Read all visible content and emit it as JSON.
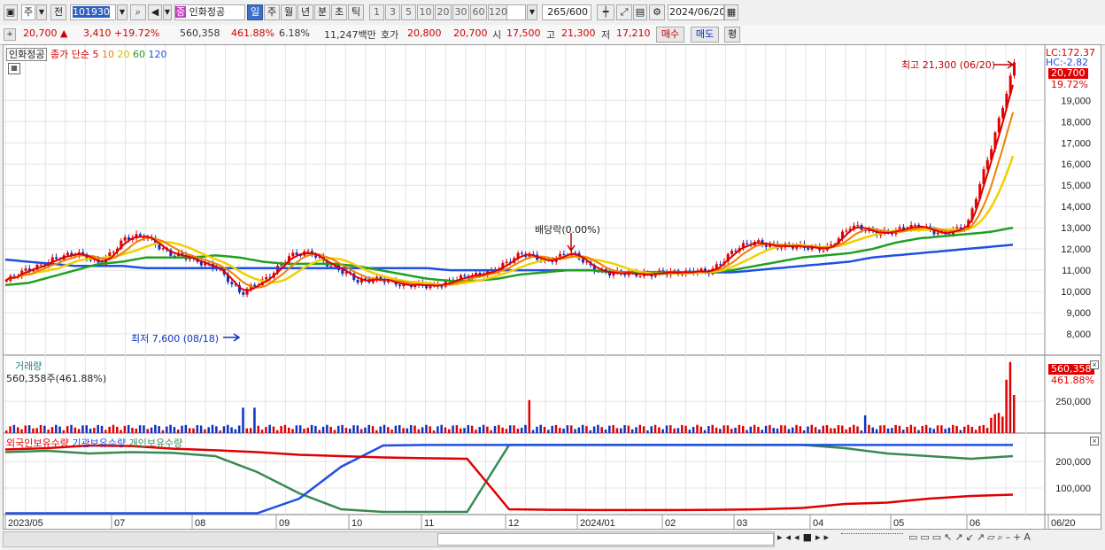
{
  "toolbar1": {
    "type_sel": "주",
    "prev_label": "전",
    "code": "101930",
    "badge": "중",
    "name": "인화정공",
    "periods": [
      "일",
      "주",
      "월",
      "년",
      "분",
      "초",
      "틱"
    ],
    "active_period": "일",
    "nums": [
      "1",
      "3",
      "5",
      "10",
      "20",
      "30",
      "60",
      "120"
    ],
    "count": "265",
    "count_total": "/600",
    "date": "2024/06/20"
  },
  "toolbar2": {
    "price": "20,700 ▲",
    "change": "3,410 +19.72%",
    "volume": "560,358",
    "volume_pct": "461.88%",
    "turnover": "6.18%",
    "amount": "11,247백만",
    "ask_label": "호가",
    "ask1": "20,800",
    "ask2": "20,700",
    "open_label": "시",
    "open": "17,500",
    "high_label": "고",
    "high": "21,300",
    "low_label": "저",
    "low": "17,210",
    "buy": "매수",
    "sell": "매도",
    "eval": "평"
  },
  "legend": {
    "name": "인화정공",
    "ma_label": "종가 단순",
    "ma": [
      "5",
      "10",
      "20",
      "60",
      "120"
    ],
    "volume_title": "거래량",
    "volume_value": "560,358주(461.88%)",
    "holdings": [
      "외국인보유수량",
      "기관보유수량",
      "개인보유수량"
    ]
  },
  "annotations": {
    "lc": "LC:172.37",
    "hc": "HC:-2.82",
    "high": "최고 21,300 (06/20)",
    "low": "최저 7,600 (08/18)",
    "dividend": "배당락(0.00%)",
    "price_tag": "20,700",
    "pct_tag": "19.72%",
    "vol_tag": "560,358",
    "vol_pct_tag": "461.88%"
  },
  "colors": {
    "up": "#e00000",
    "down": "#1030c0",
    "ma5": "#e00000",
    "ma10": "#f08000",
    "ma20": "#f0d000",
    "ma60": "#20a020",
    "ma120": "#2050e0",
    "foreign": "#e00000",
    "institution": "#2050e0",
    "individual": "#3a8a50"
  },
  "chart_data": [
    {
      "type": "line",
      "title": "인화정공 일봉",
      "y_ticks": [
        8000,
        9000,
        10000,
        11000,
        12000,
        13000,
        14000,
        15000,
        16000,
        17000,
        18000,
        19000
      ],
      "ylim": [
        7000,
        21600
      ],
      "x_ticks": [
        "2023/05",
        "07",
        "08",
        "09",
        "10",
        "11",
        "12",
        "2024/01",
        "02",
        "03",
        "04",
        "05",
        "06",
        "06/20"
      ],
      "series": [
        {
          "name": "종가",
          "values": [
            10500,
            11000,
            11600,
            11700,
            11400,
            12400,
            12600,
            11800,
            11400,
            11200,
            9800,
            10600,
            11600,
            11800,
            11200,
            10400,
            10700,
            10200,
            10300,
            10500,
            10700,
            11200,
            11700,
            11500,
            11800,
            11100,
            10900,
            10700,
            11000,
            10800,
            11000,
            11900,
            12300,
            12200,
            12000,
            12100,
            13000,
            12800,
            12900,
            13000,
            12800,
            13000,
            16800,
            20700
          ]
        },
        {
          "name": "120",
          "values": [
            11500,
            11400,
            11300,
            11200,
            11200,
            11200,
            11100,
            11100,
            11100,
            11100,
            11100,
            11100,
            11100,
            11100,
            11100,
            11100,
            11100,
            11100,
            11100,
            11000,
            11000,
            11000,
            11000,
            11000,
            11000,
            11000,
            10900,
            10900,
            10900,
            10900,
            10900,
            10900,
            11000,
            11100,
            11200,
            11300,
            11400,
            11600,
            11700,
            11800,
            11900,
            12000,
            12100,
            12200
          ]
        },
        {
          "name": "60",
          "values": [
            10300,
            10400,
            10700,
            11000,
            11300,
            11400,
            11600,
            11600,
            11600,
            11700,
            11600,
            11400,
            11300,
            11300,
            11300,
            11200,
            11000,
            10800,
            10600,
            10500,
            10500,
            10600,
            10800,
            10900,
            11000,
            11000,
            10900,
            10900,
            10900,
            10900,
            10900,
            11000,
            11200,
            11400,
            11600,
            11700,
            11800,
            12000,
            12300,
            12500,
            12600,
            12700,
            12800,
            13000
          ]
        }
      ]
    },
    {
      "type": "bar",
      "title": "거래량",
      "y_ticks": [
        250000
      ],
      "last_value": 560358
    },
    {
      "type": "line",
      "title": "보유수량",
      "y_ticks": [
        100000,
        200000
      ],
      "series": [
        {
          "name": "외국인보유수량",
          "values": [
            245000,
            250000,
            260000,
            258000,
            248000,
            242000,
            235000,
            225000,
            220000,
            215000,
            212000,
            210000,
            20000,
            18000,
            17000,
            17000,
            17000,
            18000,
            20000,
            25000,
            40000,
            45000,
            60000,
            70000,
            75000
          ]
        },
        {
          "name": "기관보유수량",
          "values": [
            5000,
            5000,
            5000,
            5000,
            5000,
            5000,
            5000,
            60000,
            180000,
            260000,
            262000,
            262000,
            262000,
            262000,
            262000,
            262000,
            262000,
            262000,
            262000,
            262000,
            262000,
            262000,
            262000,
            262000,
            262000
          ]
        },
        {
          "name": "개인보유수량",
          "values": [
            235000,
            240000,
            230000,
            235000,
            232000,
            220000,
            160000,
            80000,
            20000,
            10000,
            10000,
            10000,
            262000,
            262000,
            262000,
            262000,
            262000,
            262000,
            262000,
            262000,
            250000,
            230000,
            220000,
            210000,
            220000
          ]
        }
      ]
    }
  ]
}
